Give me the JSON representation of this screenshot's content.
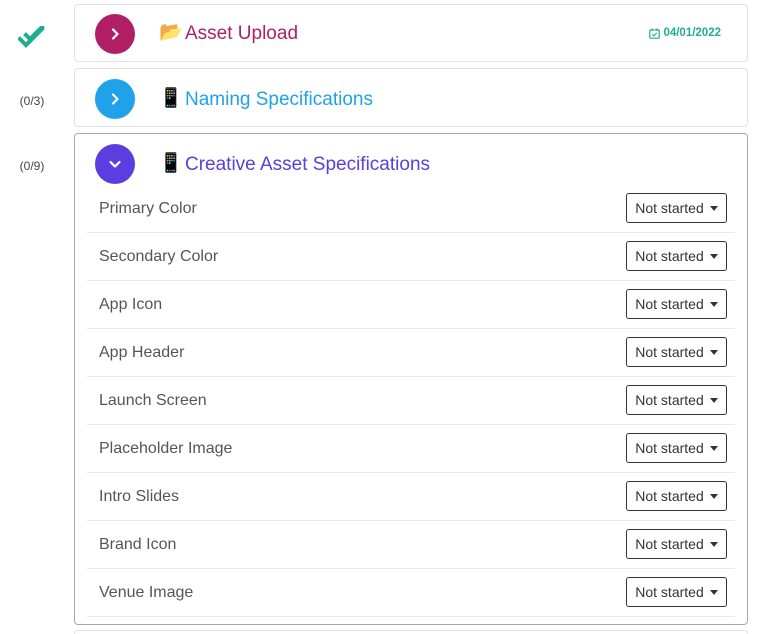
{
  "sections": [
    {
      "indicator": "",
      "emoji": "📂",
      "title": "Asset Upload",
      "color": "#b01f66",
      "date": "04/01/2022",
      "expanded": false
    },
    {
      "indicator": "(0/3)",
      "emoji": "📱",
      "title": "Naming Specifications",
      "color": "#1fa2ea",
      "expanded": false
    },
    {
      "indicator": "(0/9)",
      "emoji": "📱",
      "title": "Creative Asset Specifications",
      "color": "#5a3ee0",
      "expanded": true,
      "items": [
        {
          "label": "Primary Color",
          "status": "Not started"
        },
        {
          "label": "Secondary Color",
          "status": "Not started"
        },
        {
          "label": "App Icon",
          "status": "Not started"
        },
        {
          "label": "App Header",
          "status": "Not started"
        },
        {
          "label": "Launch Screen",
          "status": "Not started"
        },
        {
          "label": "Placeholder Image",
          "status": "Not started"
        },
        {
          "label": "Intro Slides",
          "status": "Not started"
        },
        {
          "label": "Brand Icon",
          "status": "Not started"
        },
        {
          "label": "Venue Image",
          "status": "Not started"
        }
      ]
    }
  ],
  "colors": {
    "complete_check": "#1fae8e",
    "date": "#1fae8e"
  }
}
